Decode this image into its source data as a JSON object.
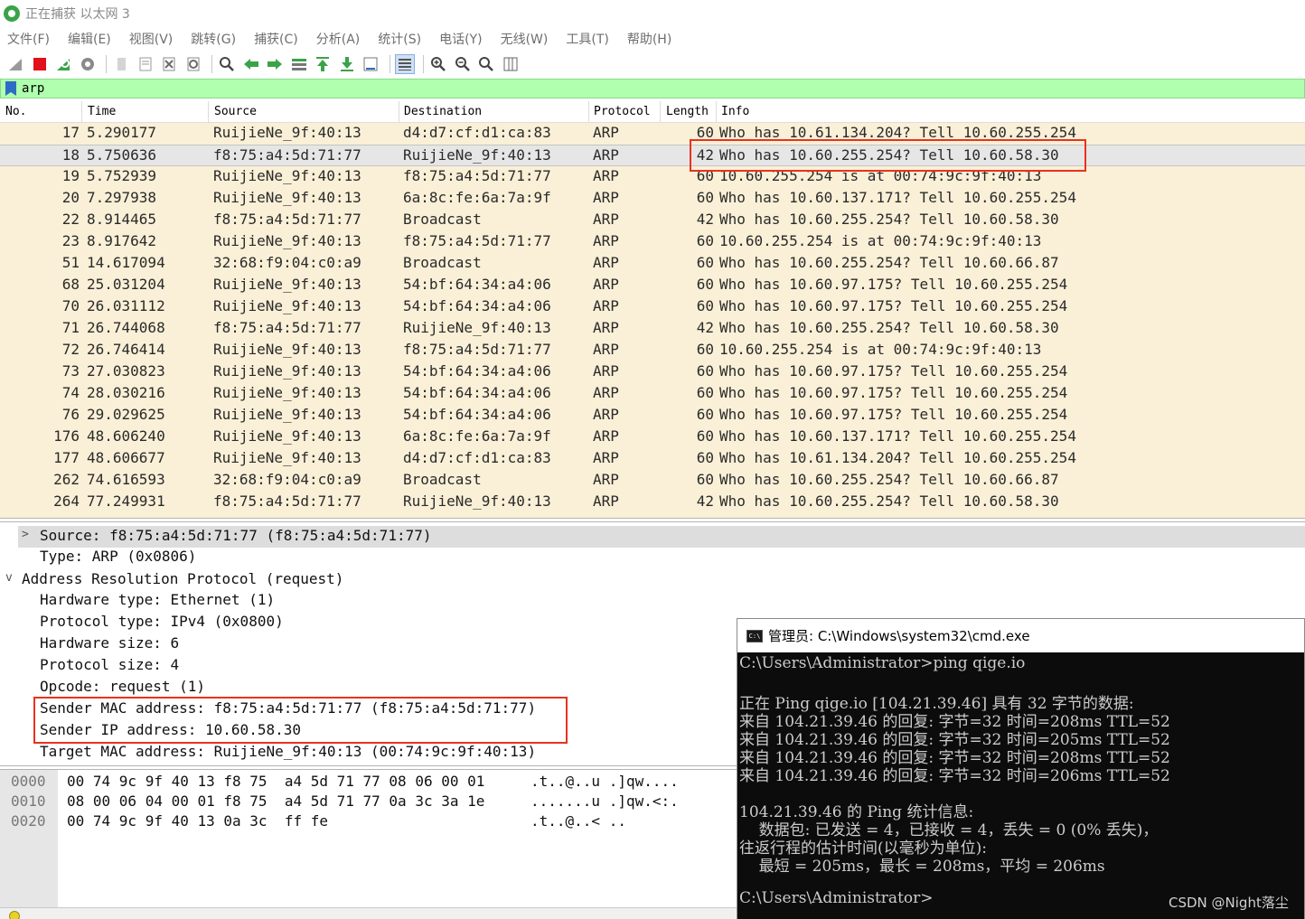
{
  "window": {
    "title": "正在捕获 以太网 3"
  },
  "menu": [
    "文件(F)",
    "编辑(E)",
    "视图(V)",
    "跳转(G)",
    "捕获(C)",
    "分析(A)",
    "统计(S)",
    "电话(Y)",
    "无线(W)",
    "工具(T)",
    "帮助(H)"
  ],
  "toolbar": {
    "icons": [
      "shark-fin-start-icon",
      "stop-capture-icon",
      "restart-capture-icon",
      "capture-options-icon",
      "open-file-icon",
      "save-file-icon",
      "close-file-icon",
      "reload-icon",
      "find-packet-icon",
      "go-back-icon",
      "go-forward-icon",
      "go-to-packet-icon",
      "go-first-icon",
      "go-last-icon",
      "autoscroll-icon",
      "colorize-icon",
      "zoom-in-icon",
      "zoom-out-icon",
      "zoom-normal-icon",
      "resize-columns-icon"
    ]
  },
  "filter": {
    "value": "arp"
  },
  "packet_list": {
    "columns": [
      "No.",
      "Time",
      "Source",
      "Destination",
      "Protocol",
      "Length",
      "Info"
    ],
    "rows": [
      {
        "no": "17",
        "time": "5.290177",
        "src": "RuijieNe_9f:40:13",
        "dst": "d4:d7:cf:d1:ca:83",
        "proto": "ARP",
        "len": "60",
        "info": "Who has 10.61.134.204? Tell 10.60.255.254"
      },
      {
        "no": "18",
        "time": "5.750636",
        "src": "f8:75:a4:5d:71:77",
        "dst": "RuijieNe_9f:40:13",
        "proto": "ARP",
        "len": "42",
        "info": "Who has 10.60.255.254? Tell 10.60.58.30",
        "selected": true
      },
      {
        "no": "19",
        "time": "5.752939",
        "src": "RuijieNe_9f:40:13",
        "dst": "f8:75:a4:5d:71:77",
        "proto": "ARP",
        "len": "60",
        "info": "10.60.255.254 is at 00:74:9c:9f:40:13"
      },
      {
        "no": "20",
        "time": "7.297938",
        "src": "RuijieNe_9f:40:13",
        "dst": "6a:8c:fe:6a:7a:9f",
        "proto": "ARP",
        "len": "60",
        "info": "Who has 10.60.137.171? Tell 10.60.255.254"
      },
      {
        "no": "22",
        "time": "8.914465",
        "src": "f8:75:a4:5d:71:77",
        "dst": "Broadcast",
        "proto": "ARP",
        "len": "42",
        "info": "Who has 10.60.255.254? Tell 10.60.58.30"
      },
      {
        "no": "23",
        "time": "8.917642",
        "src": "RuijieNe_9f:40:13",
        "dst": "f8:75:a4:5d:71:77",
        "proto": "ARP",
        "len": "60",
        "info": "10.60.255.254 is at 00:74:9c:9f:40:13"
      },
      {
        "no": "51",
        "time": "14.617094",
        "src": "32:68:f9:04:c0:a9",
        "dst": "Broadcast",
        "proto": "ARP",
        "len": "60",
        "info": "Who has 10.60.255.254? Tell 10.60.66.87"
      },
      {
        "no": "68",
        "time": "25.031204",
        "src": "RuijieNe_9f:40:13",
        "dst": "54:bf:64:34:a4:06",
        "proto": "ARP",
        "len": "60",
        "info": "Who has 10.60.97.175? Tell 10.60.255.254"
      },
      {
        "no": "70",
        "time": "26.031112",
        "src": "RuijieNe_9f:40:13",
        "dst": "54:bf:64:34:a4:06",
        "proto": "ARP",
        "len": "60",
        "info": "Who has 10.60.97.175? Tell 10.60.255.254"
      },
      {
        "no": "71",
        "time": "26.744068",
        "src": "f8:75:a4:5d:71:77",
        "dst": "RuijieNe_9f:40:13",
        "proto": "ARP",
        "len": "42",
        "info": "Who has 10.60.255.254? Tell 10.60.58.30"
      },
      {
        "no": "72",
        "time": "26.746414",
        "src": "RuijieNe_9f:40:13",
        "dst": "f8:75:a4:5d:71:77",
        "proto": "ARP",
        "len": "60",
        "info": "10.60.255.254 is at 00:74:9c:9f:40:13"
      },
      {
        "no": "73",
        "time": "27.030823",
        "src": "RuijieNe_9f:40:13",
        "dst": "54:bf:64:34:a4:06",
        "proto": "ARP",
        "len": "60",
        "info": "Who has 10.60.97.175? Tell 10.60.255.254"
      },
      {
        "no": "74",
        "time": "28.030216",
        "src": "RuijieNe_9f:40:13",
        "dst": "54:bf:64:34:a4:06",
        "proto": "ARP",
        "len": "60",
        "info": "Who has 10.60.97.175? Tell 10.60.255.254"
      },
      {
        "no": "76",
        "time": "29.029625",
        "src": "RuijieNe_9f:40:13",
        "dst": "54:bf:64:34:a4:06",
        "proto": "ARP",
        "len": "60",
        "info": "Who has 10.60.97.175? Tell 10.60.255.254"
      },
      {
        "no": "176",
        "time": "48.606240",
        "src": "RuijieNe_9f:40:13",
        "dst": "6a:8c:fe:6a:7a:9f",
        "proto": "ARP",
        "len": "60",
        "info": "Who has 10.60.137.171? Tell 10.60.255.254"
      },
      {
        "no": "177",
        "time": "48.606677",
        "src": "RuijieNe_9f:40:13",
        "dst": "d4:d7:cf:d1:ca:83",
        "proto": "ARP",
        "len": "60",
        "info": "Who has 10.61.134.204? Tell 10.60.255.254"
      },
      {
        "no": "262",
        "time": "74.616593",
        "src": "32:68:f9:04:c0:a9",
        "dst": "Broadcast",
        "proto": "ARP",
        "len": "60",
        "info": "Who has 10.60.255.254? Tell 10.60.66.87"
      },
      {
        "no": "264",
        "time": "77.249931",
        "src": "f8:75:a4:5d:71:77",
        "dst": "RuijieNe_9f:40:13",
        "proto": "ARP",
        "len": "42",
        "info": "Who has 10.60.255.254? Tell 10.60.58.30"
      }
    ]
  },
  "details": {
    "lines": [
      {
        "text": "Source: f8:75:a4:5d:71:77 (f8:75:a4:5d:71:77)",
        "caret": ">",
        "indent": 1,
        "highlight": true
      },
      {
        "text": "Type: ARP (0x0806)",
        "caret": "",
        "indent": 1
      },
      {
        "text": "Address Resolution Protocol (request)",
        "caret": "v",
        "indent": 0
      },
      {
        "text": "Hardware type: Ethernet (1)",
        "caret": "",
        "indent": 1
      },
      {
        "text": "Protocol type: IPv4 (0x0800)",
        "caret": "",
        "indent": 1
      },
      {
        "text": "Hardware size: 6",
        "caret": "",
        "indent": 1
      },
      {
        "text": "Protocol size: 4",
        "caret": "",
        "indent": 1
      },
      {
        "text": "Opcode: request (1)",
        "caret": "",
        "indent": 1
      },
      {
        "text": "Sender MAC address: f8:75:a4:5d:71:77 (f8:75:a4:5d:71:77)",
        "caret": "",
        "indent": 1
      },
      {
        "text": "Sender IP address: 10.60.58.30",
        "caret": "",
        "indent": 1
      },
      {
        "text": "Target MAC address: RuijieNe_9f:40:13 (00:74:9c:9f:40:13)",
        "caret": "",
        "indent": 1
      }
    ]
  },
  "bytes": {
    "rows": [
      {
        "offset": "0000",
        "hex": "00 74 9c 9f 40 13 f8 75  a4 5d 71 77 08 06 00 01",
        "ascii": ".t..@..u .]qw...."
      },
      {
        "offset": "0010",
        "hex": "08 00 06 04 00 01 f8 75  a4 5d 71 77 0a 3c 3a 1e",
        "ascii": ".......u .]qw.<:."
      },
      {
        "offset": "0020",
        "hex": "00 74 9c 9f 40 13 0a 3c  ff fe",
        "ascii": ".t..@..< .."
      }
    ]
  },
  "cmd": {
    "title": "管理员: C:\\Windows\\system32\\cmd.exe",
    "lines": [
      "C:\\Users\\Administrator>ping qige.io",
      "",
      "正在 Ping qige.io [104.21.39.46] 具有 32 字节的数据:",
      "来自 104.21.39.46 的回复: 字节=32 时间=208ms TTL=52",
      "来自 104.21.39.46 的回复: 字节=32 时间=205ms TTL=52",
      "来自 104.21.39.46 的回复: 字节=32 时间=208ms TTL=52",
      "来自 104.21.39.46 的回复: 字节=32 时间=206ms TTL=52",
      "",
      "104.21.39.46 的 Ping 统计信息:",
      "    数据包: 已发送 = 4，已接收 = 4，丢失 = 0 (0% 丢失)，",
      "往返行程的估计时间(以毫秒为单位):",
      "    最短 = 205ms，最长 = 208ms，平均 = 206ms",
      "",
      "C:\\Users\\Administrator>"
    ]
  },
  "watermark": "CSDN @Night落尘",
  "colors": {
    "packet_bg": "#faf0d7",
    "selected_bg": "#e6e6e6",
    "filter_bg": "#afffaf",
    "highlight_box": "#e8321e",
    "cmd_bg": "#0c0c0c"
  }
}
